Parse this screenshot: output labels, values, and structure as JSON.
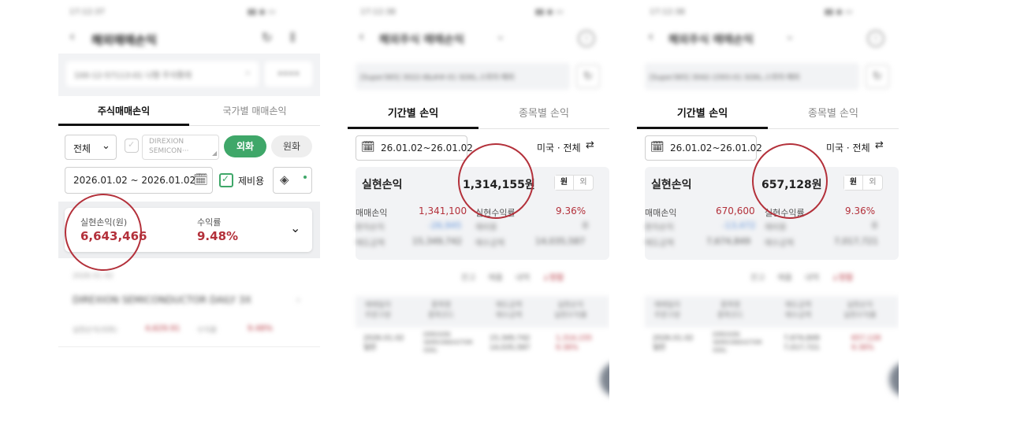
{
  "panel1": {
    "status_time": "17:12:37",
    "title": "해외매매손익",
    "account": "100-12-57113-01 나형 주식통데",
    "account_pw": "••••",
    "tabs": [
      {
        "label": "주식매매손익"
      },
      {
        "label": "국가별 매매손익"
      }
    ],
    "filter_all": "전체",
    "stock_name_line1": "DIREXION",
    "stock_name_line2": "SEMICON···",
    "btn_foreign": "외화",
    "btn_krw": "원화",
    "date_range": "2026.01.02 ~ 2026.01.02",
    "expense_label": "제비용",
    "realized_label": "실현손익(원)",
    "realized_value": "6,643,466",
    "return_label": "수익률",
    "return_value": "9.48%",
    "list_date": "2026.01.02",
    "list_stock": "DIREXION SEMICONDUCTOR DAILY 3X",
    "list_realized_label": "실현손익(외화)",
    "list_realized_value": "4,629.91",
    "list_return_label": "수익률",
    "list_return_value": "9.48%"
  },
  "panel2": {
    "status_time": "17:12:38",
    "title": "해외주식 매매손익",
    "account": "[Super365] 3022-8&##-01 SOXL.스위치·해외",
    "tabs": [
      {
        "label": "기간별 손익"
      },
      {
        "label": "종목별 손익"
      }
    ],
    "date_range": "26.01.02~26.01.02",
    "market_filter": "미국 · 전체",
    "realized_label": "실현손익",
    "realized_value": "1,314,155원",
    "toggle_won": "원",
    "toggle_foreign": "외",
    "rows": [
      {
        "l1": "매매손익",
        "v1": "1,341,100",
        "l2": "실현수익률",
        "v2": "9.36%"
      },
      {
        "l1": "환차손익",
        "v1": "-26,945",
        "l2": "제비용",
        "v2": "0"
      },
      {
        "l1": "매도금액",
        "v1": "15,349,742",
        "l2": "매수금액",
        "v2": "14,035,587"
      }
    ],
    "sort_options": [
      "잔고",
      "매출",
      "내역",
      "↓정렬"
    ],
    "table_headers": [
      [
        "매매일자",
        "주문구분"
      ],
      [
        "종목명",
        "종목코드"
      ],
      [
        "매도금액",
        "매수금액"
      ],
      [
        "실현손익",
        "실현수익률"
      ]
    ],
    "table_row": [
      [
        "2026.01.02",
        "일반"
      ],
      [
        "DIREXION",
        "SEMICONDUCTOR",
        "SOXL"
      ],
      [
        "15,349,742",
        "14,035,587"
      ],
      [
        "1,314,155",
        "9.36%"
      ]
    ]
  },
  "panel3": {
    "status_time": "17:12:38",
    "title": "해외주식 매매손익",
    "account": "[Super365] 3042-1593-01 SOXL.스위치·해외",
    "tabs": [
      {
        "label": "기간별 손익"
      },
      {
        "label": "종목별 손익"
      }
    ],
    "date_range": "26.01.02~26.01.02",
    "market_filter": "미국 · 전체",
    "realized_label": "실현손익",
    "realized_value": "657,128원",
    "toggle_won": "원",
    "toggle_foreign": "외",
    "rows": [
      {
        "l1": "매매손익",
        "v1": "670,600",
        "l2": "실현수익률",
        "v2": "9.36%"
      },
      {
        "l1": "환차손익",
        "v1": "-13,472",
        "l2": "제비용",
        "v2": "0"
      },
      {
        "l1": "매도금액",
        "v1": "7,674,849",
        "l2": "매수금액",
        "v2": "7,017,721"
      }
    ],
    "sort_options": [
      "잔고",
      "매출",
      "내역",
      "↓정렬"
    ],
    "table_headers": [
      [
        "매매일자",
        "주문구분"
      ],
      [
        "종목명",
        "종목코드"
      ],
      [
        "매도금액",
        "매수금액"
      ],
      [
        "실현손익",
        "실현수익률"
      ]
    ],
    "table_row": [
      [
        "2026.01.02",
        "일반"
      ],
      [
        "DIREXION",
        "SEMICONDUCTOR",
        "SOXL"
      ],
      [
        "7,674,849",
        "7,017,721"
      ],
      [
        "657,128",
        "9.36%"
      ]
    ]
  },
  "colors": {
    "accent_green": "#3fa769",
    "profit_red": "#b3303a",
    "loss_blue": "#5b8fd8",
    "circle": "#b3303a"
  }
}
